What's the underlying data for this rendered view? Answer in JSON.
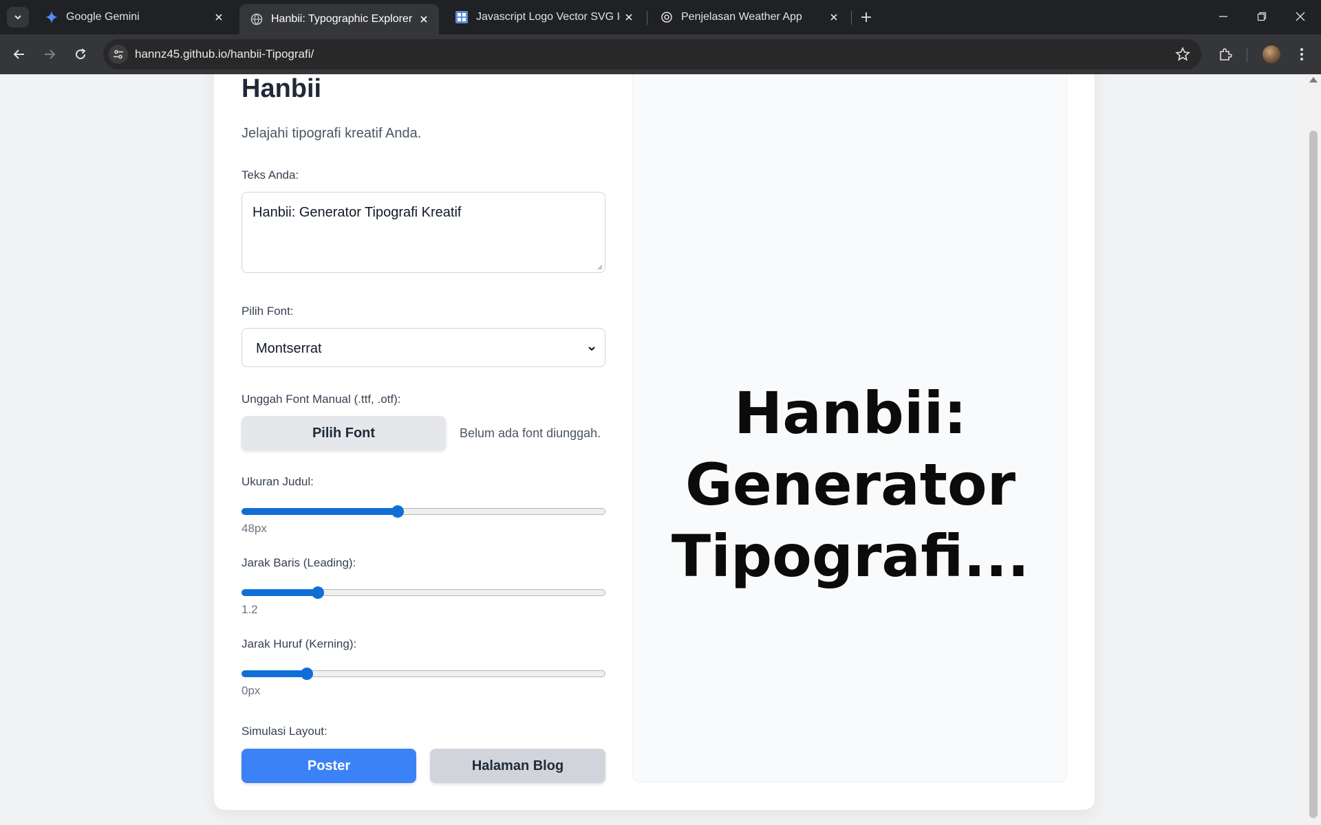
{
  "browser": {
    "tabs": [
      {
        "title": "Google Gemini",
        "icon": "gemini-icon",
        "active": false
      },
      {
        "title": "Hanbii: Typographic Explorer",
        "icon": "globe-icon",
        "active": true
      },
      {
        "title": "Javascript Logo Vector SVG Icon",
        "icon": "svgrepo-icon",
        "active": false
      },
      {
        "title": "Penjelasan Weather App",
        "icon": "chatgpt-icon",
        "active": false
      }
    ],
    "url": "hannz45.github.io/hanbii-Tipografi/"
  },
  "app": {
    "title": "Hanbii",
    "subtitle": "Jelajahi tipografi kreatif Anda.",
    "text_label": "Teks Anda:",
    "text_value": "Hanbii: Generator Tipografi Kreatif",
    "font_label": "Pilih Font:",
    "font_selected": "Montserrat",
    "upload_label": "Unggah Font Manual (.ttf, .otf):",
    "upload_button": "Pilih Font",
    "upload_status": "Belum ada font diunggah.",
    "size_label": "Ukuran Judul:",
    "size_value": "48px",
    "size_fraction": 0.43,
    "leading_label": "Jarak Baris (Leading):",
    "leading_value": "1.2",
    "leading_fraction": 0.21,
    "kerning_label": "Jarak Huruf (Kerning):",
    "kerning_value": "0px",
    "kerning_fraction": 0.18,
    "layout_label": "Simulasi Layout:",
    "layout_poster": "Poster",
    "layout_blog": "Halaman Blog"
  },
  "preview": {
    "lines": [
      "Hanbii:",
      "Generator",
      "Tipografi..."
    ]
  },
  "colors": {
    "accent": "#3b82f6",
    "slider": "#0f6fd6"
  }
}
